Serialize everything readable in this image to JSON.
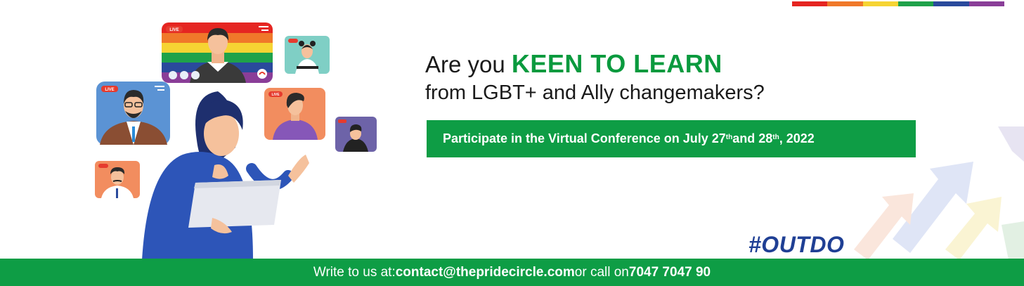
{
  "header": {
    "rainbow_colors": [
      "#e52521",
      "#f0782a",
      "#f6d433",
      "#1fa24a",
      "#2a4a9c",
      "#8a3e98"
    ]
  },
  "headline": {
    "prefix": "Are you ",
    "accent": "KEEN TO LEARN",
    "line2": "from LGBT+ and Ally changemakers?"
  },
  "cta": {
    "text_before": "Participate in the Virtual Conference on July 27",
    "sup1": "th",
    "text_mid": " and 28",
    "sup2": "th",
    "text_after": ", 2022"
  },
  "hashtag": "#OUTDO",
  "footer": {
    "write_label": "Write to us at: ",
    "email": "contact@thepridecircle.com",
    "call_label": " or call on ",
    "phone": "7047 7047 90"
  },
  "illustration": {
    "live_badge": "LIVE",
    "icons": [
      "live-video-tile-icon",
      "chat-icon",
      "camera-icon",
      "microphone-icon",
      "end-call-icon",
      "laptop-icon"
    ]
  },
  "colors": {
    "green": "#0e9d45",
    "accent_green": "#0a9a3e",
    "hashtag_blue": "#1f3f94"
  }
}
